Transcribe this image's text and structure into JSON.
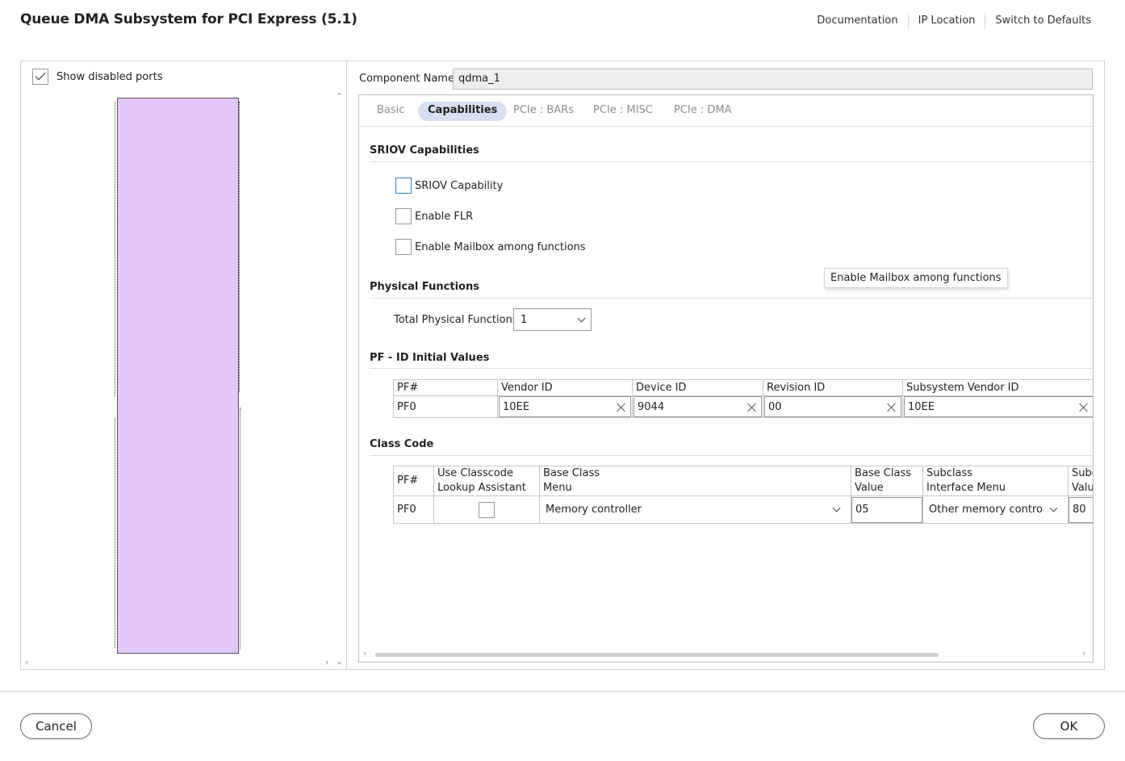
{
  "header": {
    "title": "Queue DMA Subsystem for PCI Express (5.1)",
    "links": [
      "Documentation",
      "IP Location",
      "Switch to Defaults"
    ]
  },
  "left_panel": {
    "show_disabled_ports_label": "Show disabled ports",
    "show_disabled_ports_checked": true,
    "block_color": "#e4c8fc"
  },
  "component": {
    "label": "Component Name",
    "value": "qdma_1"
  },
  "tabs": [
    {
      "label": "Basic",
      "active": false
    },
    {
      "label": "Capabilities",
      "active": true
    },
    {
      "label": "PCIe : BARs",
      "active": false
    },
    {
      "label": "PCIe : MISC",
      "active": false
    },
    {
      "label": "PCIe : DMA",
      "active": false
    }
  ],
  "sriov": {
    "title": "SRIOV Capabilities",
    "options": [
      {
        "label": "SRIOV Capability",
        "checked": false
      },
      {
        "label": "Enable FLR",
        "checked": false
      },
      {
        "label": "Enable Mailbox among functions",
        "checked": false
      }
    ]
  },
  "tooltip": "Enable Mailbox among functions",
  "physical_functions": {
    "title": "Physical Functions",
    "label": "Total Physical Functions",
    "value": "1"
  },
  "pf_id": {
    "title": "PF - ID Initial Values",
    "headers": [
      "PF#",
      "Vendor ID",
      "Device ID",
      "Revision ID",
      "Subsystem Vendor ID"
    ],
    "rows": [
      {
        "pf": "PF0",
        "vendor_id": "10EE",
        "device_id": "9044",
        "revision_id": "00",
        "subsystem_vendor_id": "10EE"
      }
    ]
  },
  "class_code": {
    "title": "Class Code",
    "headers": {
      "pf": "PF#",
      "use_classcode_1": "Use Classcode",
      "use_classcode_2": "Lookup Assistant",
      "base_class_menu_1": "Base Class",
      "base_class_menu_2": "Menu",
      "base_class_value_1": "Base Class",
      "base_class_value_2": "Value",
      "subclass_menu_1": "Subclass",
      "subclass_menu_2": "Interface Menu",
      "subclass_value_1": "Subc",
      "subclass_value_2": "Valu"
    },
    "rows": [
      {
        "pf": "PF0",
        "use_assistant": false,
        "base_class_menu": "Memory controller",
        "base_class_value": "05",
        "subclass_menu": "Other memory controlle",
        "subclass_value": "80"
      }
    ]
  },
  "footer": {
    "cancel": "Cancel",
    "ok": "OK"
  }
}
